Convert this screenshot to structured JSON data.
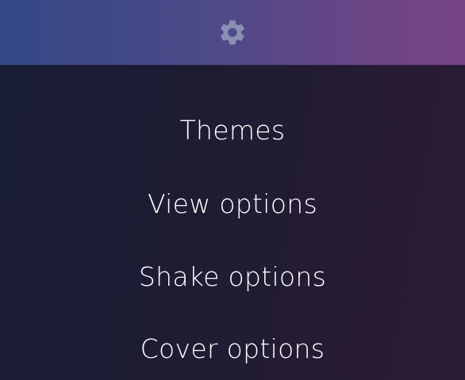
{
  "header": {
    "icon": "gear-icon",
    "gradient_left": "#344785",
    "gradient_right": "#774386",
    "icon_color": "#8a8fb6"
  },
  "menu": {
    "background": "#1c1c33",
    "text_color": "#ffffff",
    "items": [
      {
        "label": "Themes"
      },
      {
        "label": "View options"
      },
      {
        "label": "Shake options"
      },
      {
        "label": "Cover options"
      }
    ]
  }
}
